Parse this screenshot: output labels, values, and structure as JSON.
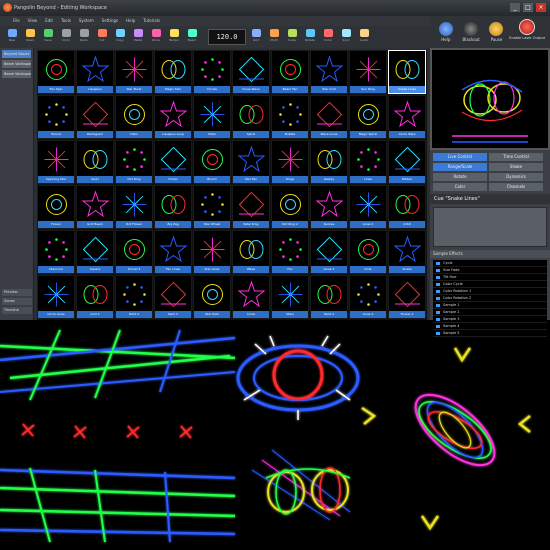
{
  "window": {
    "title": "Pangolin Beyond - Editing Workspace",
    "minimize": "_",
    "maximize": "□",
    "close": "×"
  },
  "menu": [
    "File",
    "View",
    "Edit",
    "Tools",
    "System",
    "Settings",
    "Help",
    "Tutorials"
  ],
  "toolbar": {
    "buttons": [
      "New",
      "Open",
      "Save",
      "Undo",
      "Redo",
      "Cut",
      "Copy",
      "Paste",
      "Zone",
      "Tempo",
      "Beam",
      "Grid",
      "Multi",
      "Scale",
      "Rotate",
      "Color",
      "Sync",
      "Audio"
    ],
    "tempo_value": "120.0"
  },
  "top_right": {
    "help": "Help",
    "blackout": "Blackout",
    "pause": "Pause",
    "enable_output": "Enable Laser Output"
  },
  "sidebar": {
    "items": [
      "Beyond Basics",
      "Beam Workspace 1",
      "Beam Workspace 2"
    ],
    "bottom": [
      "Preview",
      "Zones",
      "Timeline"
    ]
  },
  "grid": {
    "rows": [
      [
        "Fan Spin",
        "Lissajous",
        "Star Burst",
        "Magic Star",
        "Circles",
        "Cross Wave",
        "Beam Fan",
        "Star Grid",
        "Sun Ring",
        "Snake Lines"
      ],
      [
        "Tunnel",
        "Pentagram",
        "Helix",
        "Lissajous Loop",
        "Petal",
        "Spiral",
        "Bubble",
        "Wave Lines",
        "Magic Spiral",
        "Circle Wipe"
      ],
      [
        "Spinning Star",
        "Swirl",
        "Dot Ring",
        "Vortex",
        "Bloom",
        "Star Fan",
        "Rings",
        "Galaxy",
        "Lines",
        "Ribbon"
      ],
      [
        "Flower",
        "Grid Beam",
        "Dot Flower",
        "Zig Zag",
        "Star Wheel",
        "Petal Ring",
        "Dot Ring 2",
        "Spokes",
        "Lines 2",
        "Orbit"
      ],
      [
        "Diamond",
        "Square",
        "Tunnel 2",
        "Fan Lines",
        "Star Lines",
        "Wave",
        "Fan",
        "Lines 3",
        "Dots",
        "Snake"
      ],
      [
        "Circle Lines",
        "Grid 2",
        "Orbit 2",
        "Swirl 2",
        "Star Dots",
        "Cross",
        "Stars",
        "Helix 2",
        "Lines 4",
        "Flower 2"
      ]
    ]
  },
  "panel": {
    "tabs": [
      "Live Control",
      "Time Control",
      "Range/Scale",
      "Shake",
      "Rotate",
      "Dynamics",
      "Color",
      "Channels"
    ],
    "cue_title": "Cue \"Snake Lines\"",
    "effects_header": "Sample Effects",
    "effects": [
      "Cycle",
      "Size Fade",
      "Tilt Hue",
      "Color Cycle",
      "Color Rotation 1",
      "Color Rotation 2",
      "Sample 1",
      "Sample 2",
      "Sample 3",
      "Sample 4",
      "Sample 5"
    ]
  },
  "colors": {
    "accent": "#2d6ec9",
    "laser_green": "#20ff4a",
    "laser_blue": "#2a5bff",
    "laser_red": "#ff2a2a",
    "laser_yellow": "#e8e020",
    "laser_magenta": "#ff30e0"
  }
}
